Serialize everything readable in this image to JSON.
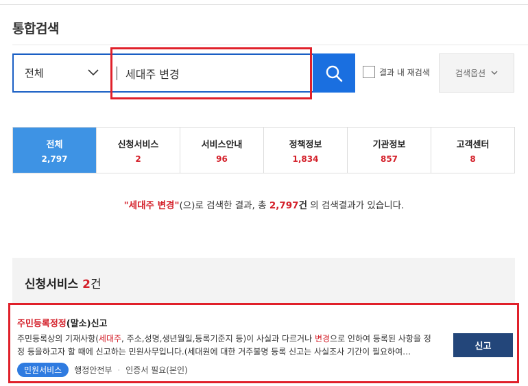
{
  "page": {
    "title": "통합검색"
  },
  "search": {
    "scope": "전체",
    "query": "세대주 변경",
    "re_search_label": "결과 내 재검색",
    "options_label": "검색옵션"
  },
  "tabs": [
    {
      "label": "전체",
      "count": "2,797",
      "active": true
    },
    {
      "label": "신청서비스",
      "count": "2"
    },
    {
      "label": "서비스안내",
      "count": "96"
    },
    {
      "label": "정책정보",
      "count": "1,834"
    },
    {
      "label": "기관정보",
      "count": "857"
    },
    {
      "label": "고객센터",
      "count": "8"
    }
  ],
  "summary": {
    "keyword": "\"세대주 변경\"",
    "text1": "(으)로 검색한 결과, 총",
    "total": "2,797",
    "unit": "건",
    "text2": "의 검색결과가 있습니다."
  },
  "section": {
    "title": "신청서비스",
    "count": "2",
    "unit": "건"
  },
  "result": {
    "title_hl": "주민등록정정",
    "title_rest": "(말소)신고",
    "desc_1": "주민등록상의 기재사항(",
    "desc_hl_1": "세대주",
    "desc_2": ", 주소,성명,생년월일,등록기준지 등)이 사실과 다르거나 ",
    "desc_hl_2": "변경",
    "desc_3": "으로 인하여 등록된 사항을 정정 등을하고자 할 때에 신고하는 민원사무입니다.(세대원에 대한 거주불명 등록 신고는 사실조사 기간이 필요하여…",
    "badge": "민원서비스",
    "agency": "행정안전부",
    "cert": "인증서 필요(본인)",
    "apply_label": "신고"
  },
  "colors": {
    "primary_blue": "#1a6fe0",
    "active_tab": "#3e93e4",
    "highlight_red": "#d4202a",
    "annotation_red": "#e0202a",
    "apply_button": "#23467a"
  }
}
